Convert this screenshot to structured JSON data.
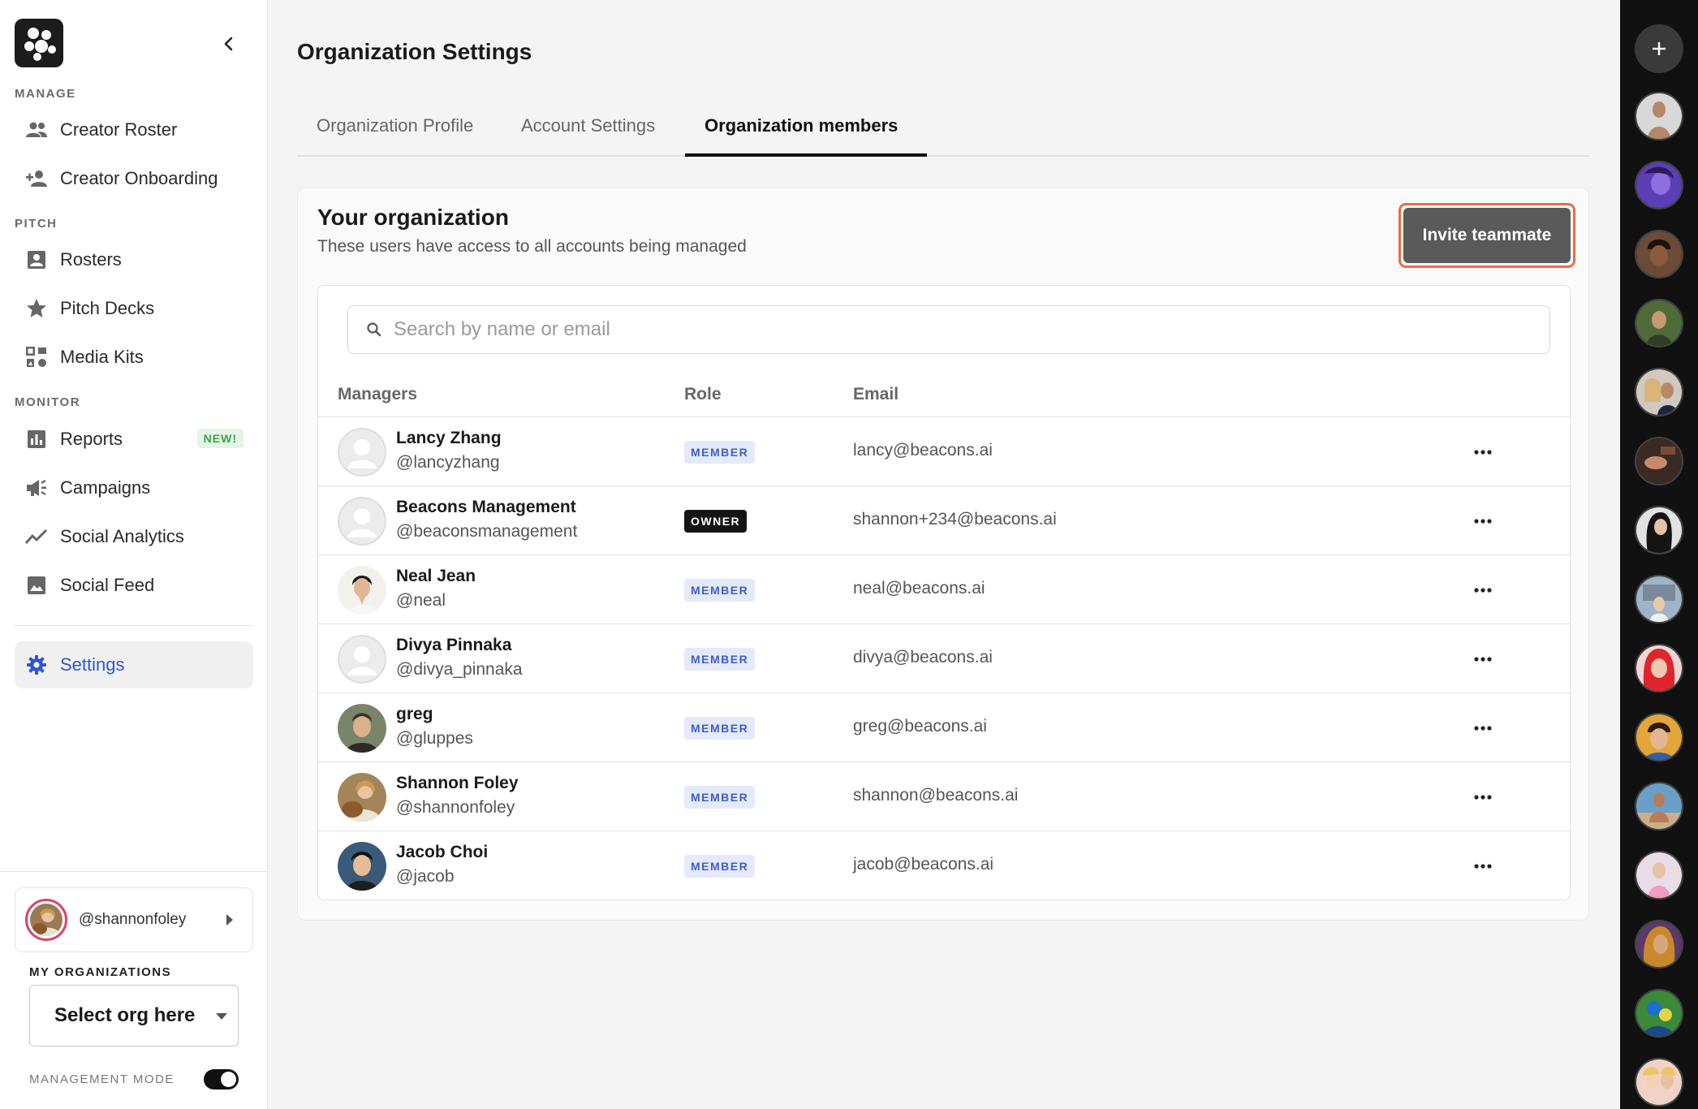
{
  "sidebar": {
    "sections": {
      "manage": "MANAGE",
      "pitch": "PITCH",
      "monitor": "MONITOR"
    },
    "items": [
      {
        "label": "Creator Roster",
        "icon": "people-icon"
      },
      {
        "label": "Creator Onboarding",
        "icon": "person-add-icon"
      },
      {
        "label": "Rosters",
        "icon": "contact-card-icon"
      },
      {
        "label": "Pitch Decks",
        "icon": "star-icon"
      },
      {
        "label": "Media Kits",
        "icon": "media-kit-icon"
      },
      {
        "label": "Reports",
        "icon": "bar-chart-icon",
        "badge": "NEW!"
      },
      {
        "label": "Campaigns",
        "icon": "megaphone-icon"
      },
      {
        "label": "Social Analytics",
        "icon": "trending-line-icon"
      },
      {
        "label": "Social Feed",
        "icon": "image-icon"
      },
      {
        "label": "Settings",
        "icon": "gear-icon",
        "active": true
      }
    ],
    "account_handle": "@shannonfoley",
    "my_orgs_label": "MY ORGANIZATIONS",
    "org_select_value": "Select org here",
    "management_mode_label": "MANAGEMENT MODE",
    "management_mode_on": true
  },
  "page": {
    "title": "Organization Settings",
    "tabs": [
      {
        "label": "Organization Profile"
      },
      {
        "label": "Account Settings"
      },
      {
        "label": "Organization members",
        "active": true
      }
    ]
  },
  "org": {
    "title": "Your organization",
    "subtitle": "These users have access to all accounts being managed",
    "invite_label": "Invite teammate",
    "search_placeholder": "Search by name or email",
    "columns": {
      "managers": "Managers",
      "role": "Role",
      "email": "Email"
    },
    "members": [
      {
        "name": "Lancy Zhang",
        "handle": "@lancyzhang",
        "role": "MEMBER",
        "email": "lancy@beacons.ai"
      },
      {
        "name": "Beacons Management",
        "handle": "@beaconsmanagement",
        "role": "OWNER",
        "email": "shannon+234@beacons.ai"
      },
      {
        "name": "Neal Jean",
        "handle": "@neal",
        "role": "MEMBER",
        "email": "neal@beacons.ai"
      },
      {
        "name": "Divya Pinnaka",
        "handle": "@divya_pinnaka",
        "role": "MEMBER",
        "email": "divya@beacons.ai"
      },
      {
        "name": "greg",
        "handle": "@gluppes",
        "role": "MEMBER",
        "email": "greg@beacons.ai"
      },
      {
        "name": "Shannon Foley",
        "handle": "@shannonfoley",
        "role": "MEMBER",
        "email": "shannon@beacons.ai"
      },
      {
        "name": "Jacob Choi",
        "handle": "@jacob",
        "role": "MEMBER",
        "email": "jacob@beacons.ai"
      }
    ]
  },
  "colors": {
    "accent_blue": "#2f55d4",
    "invite_outline": "#ee6b43",
    "member_badge_bg": "#e4eafb",
    "owner_badge_bg": "#151515",
    "new_badge_fg": "#3ba34f"
  }
}
